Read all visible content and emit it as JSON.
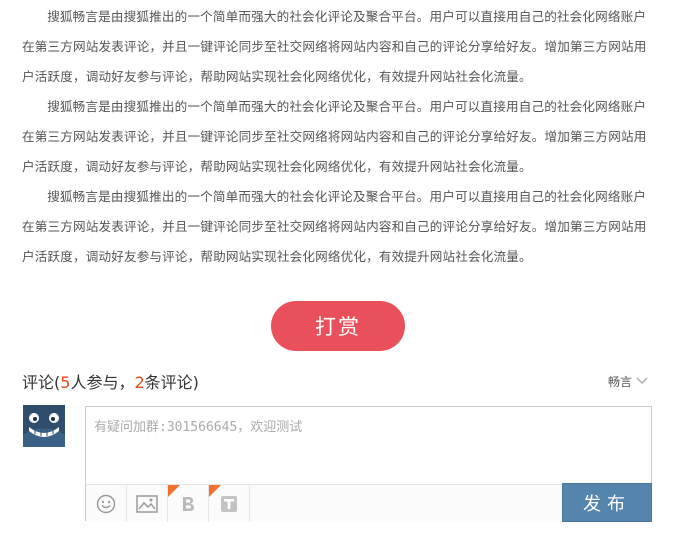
{
  "article": {
    "paragraphs": [
      "搜狐畅言是由搜狐推出的一个简单而强大的社会化评论及聚合平台。用户可以直接用自己的社会化网络账户在第三方网站发表评论，并且一键评论同步至社交网络将网站内容和自己的评论分享给好友。增加第三方网站用户活跃度，调动好友参与评论，帮助网站实现社会化网络优化，有效提升网站社会化流量。",
      "搜狐畅言是由搜狐推出的一个简单而强大的社会化评论及聚合平台。用户可以直接用自己的社会化网络账户在第三方网站发表评论，并且一键评论同步至社交网络将网站内容和自己的评论分享给好友。增加第三方网站用户活跃度，调动好友参与评论，帮助网站实现社会化网络优化，有效提升网站社会化流量。",
      "搜狐畅言是由搜狐推出的一个简单而强大的社会化评论及聚合平台。用户可以直接用自己的社会化网络账户在第三方网站发表评论，并且一键评论同步至社交网络将网站内容和自己的评论分享给好友。增加第三方网站用户活跃度，调动好友参与评论，帮助网站实现社会化网络优化，有效提升网站社会化流量。"
    ]
  },
  "reward": {
    "label": "打赏"
  },
  "comments": {
    "title_prefix": "评论(",
    "participants": "5",
    "participants_suffix": "人参与，",
    "count": "2",
    "count_suffix": "条评论)",
    "menu_label": "畅言"
  },
  "editor": {
    "placeholder": "有疑问加群:301566645，欢迎测试",
    "publish_label": "发布",
    "tools": [
      {
        "icon": "emoji-icon"
      },
      {
        "icon": "image-icon"
      },
      {
        "icon": "bold-icon",
        "flag": "N"
      },
      {
        "icon": "text-format-icon",
        "flag": "N"
      }
    ]
  },
  "colors": {
    "reward": "#e8505b",
    "publish": "#5584ad",
    "count_highlight": "#e5491f",
    "new_flag": "#f0712f"
  }
}
